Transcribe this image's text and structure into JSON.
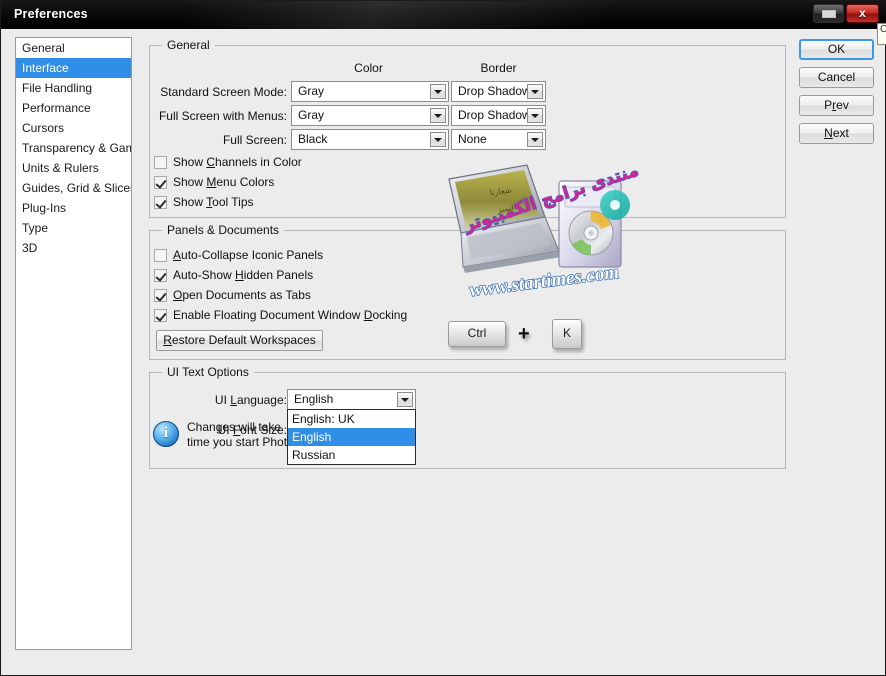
{
  "window": {
    "title": "Preferences",
    "caption_buttons": [
      {
        "name": "restore",
        "glyph": ""
      },
      {
        "name": "close",
        "glyph": "x"
      }
    ],
    "edge_sliver_text": "C"
  },
  "sidebar": {
    "items": [
      {
        "label": "General",
        "selected": false
      },
      {
        "label": "Interface",
        "selected": true
      },
      {
        "label": "File Handling",
        "selected": false
      },
      {
        "label": "Performance",
        "selected": false
      },
      {
        "label": "Cursors",
        "selected": false
      },
      {
        "label": "Transparency & Gamut",
        "selected": false
      },
      {
        "label": "Units & Rulers",
        "selected": false
      },
      {
        "label": "Guides, Grid & Slices",
        "selected": false
      },
      {
        "label": "Plug-Ins",
        "selected": false
      },
      {
        "label": "Type",
        "selected": false
      },
      {
        "label": "3D",
        "selected": false
      }
    ]
  },
  "buttons": {
    "ok": "OK",
    "cancel": "Cancel",
    "prev_pre": "P",
    "prev_mnem": "r",
    "prev_post": "ev",
    "next_pre": "",
    "next_mnem": "N",
    "next_post": "ext"
  },
  "general": {
    "legend": "General",
    "column_headers": {
      "color": "Color",
      "border": "Border"
    },
    "rows": [
      {
        "label": "Standard Screen Mode:",
        "color": "Gray",
        "border": "Drop Shadow"
      },
      {
        "label": "Full Screen with Menus:",
        "color": "Gray",
        "border": "Drop Shadow"
      },
      {
        "label": "Full Screen:",
        "color": "Black",
        "border": "None"
      }
    ],
    "checkboxes": [
      {
        "pre": "Show ",
        "mnem": "C",
        "post": "hannels in Color",
        "checked": false
      },
      {
        "pre": "Show ",
        "mnem": "M",
        "post": "enu Colors",
        "checked": true
      },
      {
        "pre": "Show ",
        "mnem": "T",
        "post": "ool Tips",
        "checked": true
      }
    ]
  },
  "panels": {
    "legend": "Panels & Documents",
    "checkboxes": [
      {
        "pre": "",
        "mnem": "A",
        "post": "uto-Collapse Iconic Panels",
        "checked": false
      },
      {
        "pre": "Auto-Show ",
        "mnem": "H",
        "post": "idden Panels",
        "checked": true
      },
      {
        "pre": "",
        "mnem": "O",
        "post": "pen Documents as Tabs",
        "checked": true
      },
      {
        "pre": "Enable Floating Document Window ",
        "mnem": "D",
        "post": "ocking",
        "checked": true
      }
    ],
    "restore_pre": "",
    "restore_mnem": "R",
    "restore_post": "estore Default Workspaces",
    "keys": {
      "ctrl": "Ctrl",
      "plus": "+",
      "k": "K"
    }
  },
  "uitext": {
    "legend": "UI Text Options",
    "language_label_pre": "UI ",
    "language_label_mnem": "L",
    "language_label_post": "anguage:",
    "language_value": "English",
    "fontsize_label_pre": "UI ",
    "fontsize_label_mnem": "F",
    "fontsize_label_post": "ont Size:",
    "language_options": [
      {
        "label": "English: UK",
        "selected": false
      },
      {
        "label": "English",
        "selected": true
      },
      {
        "label": "Russian",
        "selected": false
      }
    ],
    "info_icon": "i",
    "info_text": "Changes will take effect the next time you start Photoshop.",
    "info_line1": "Changes will take",
    "info_line2": "time you start Photoshop."
  },
  "watermark": {
    "site": "www.startimes.com",
    "arabic_top": "منتدى برامج الكمبيوتر",
    "screen_line1": "شعارنا",
    "screen_line2": "التميز"
  },
  "colors": {
    "accent": "#2f8fe8",
    "dialog_bg": "#ececec",
    "titlebar": "#000000",
    "close_button": "#c52a22",
    "focus_ring": "#3c9ade"
  }
}
